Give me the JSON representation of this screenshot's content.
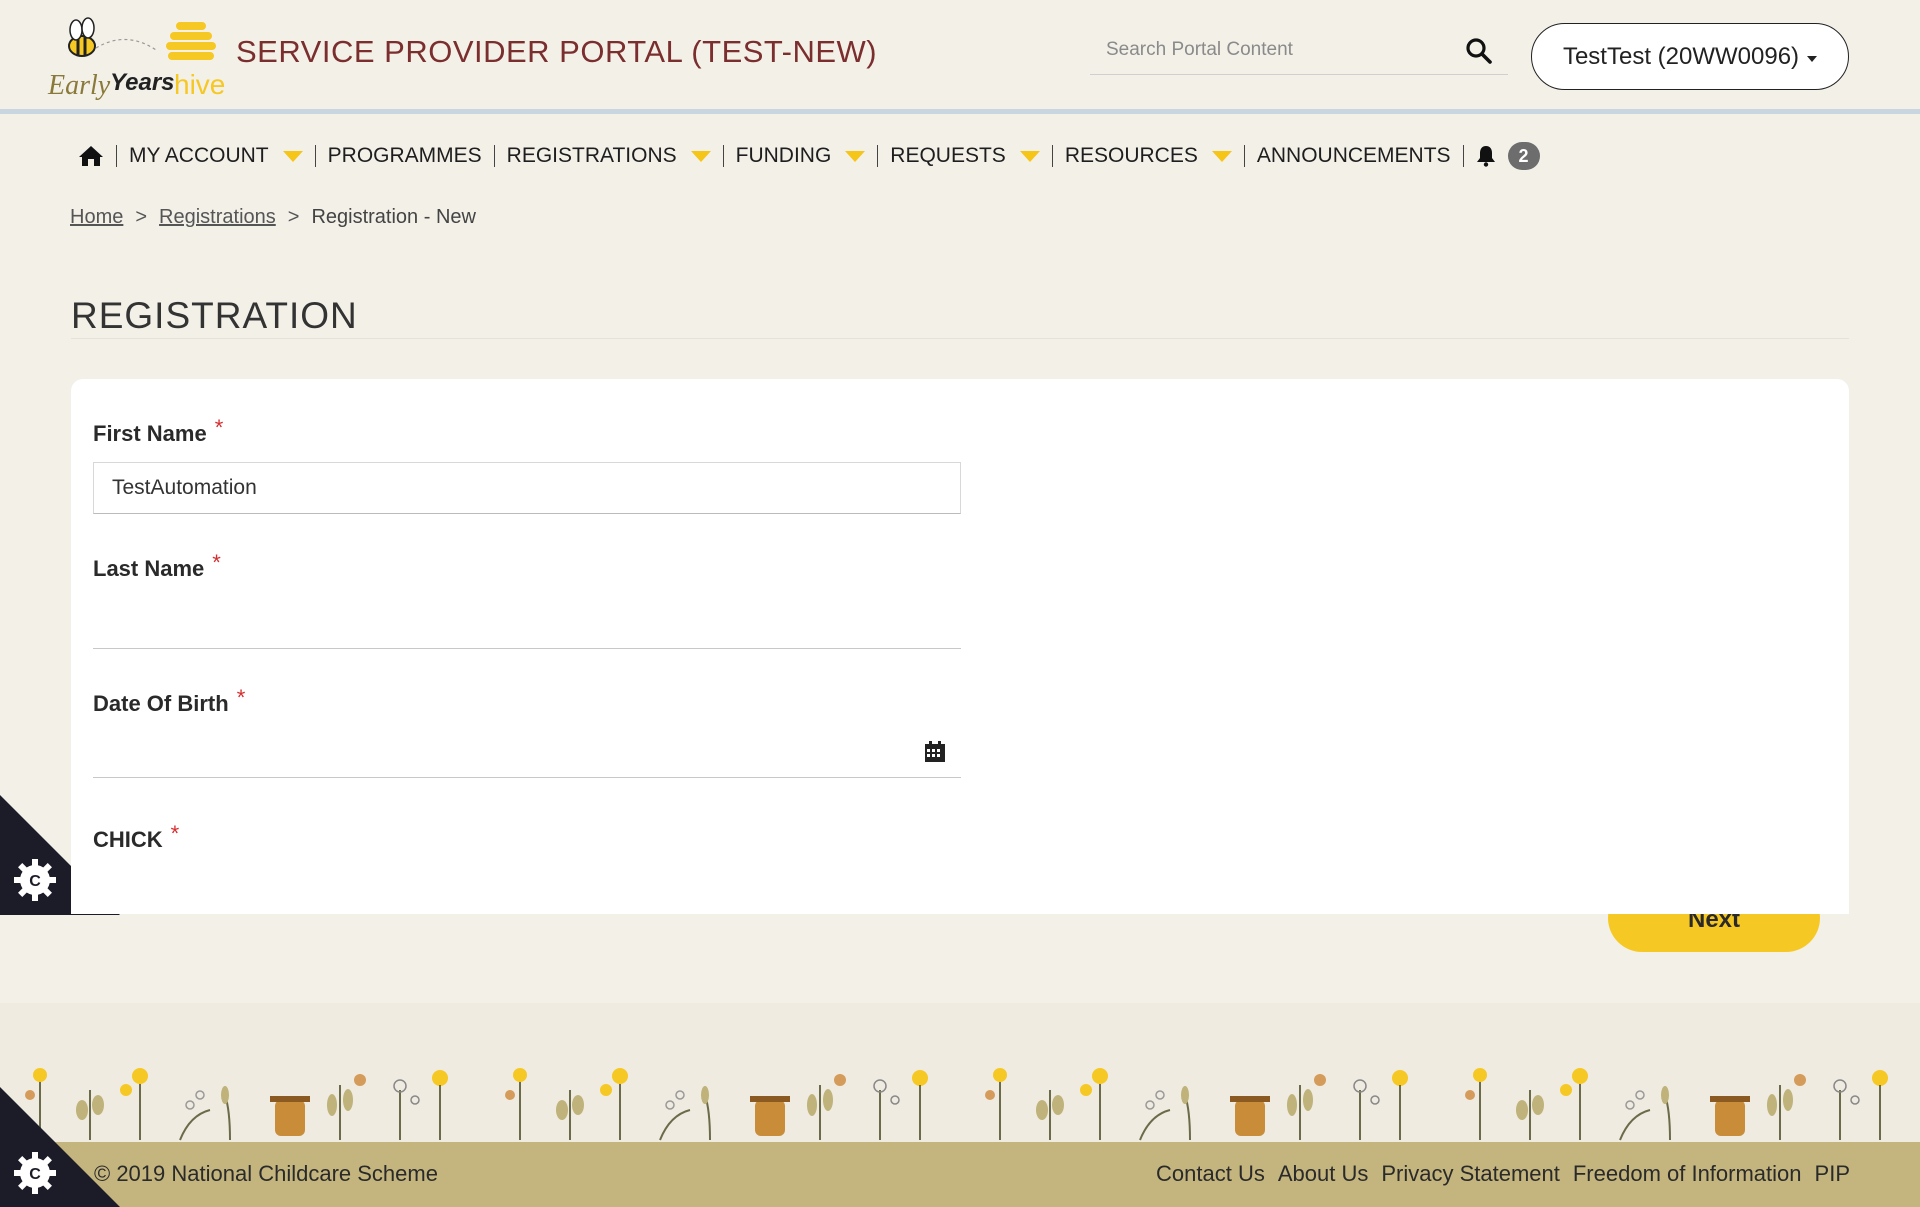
{
  "header": {
    "logo_alt": "Early Years hive",
    "logo_word_1": "Early",
    "logo_word_2": "Years",
    "logo_word_3": "hive",
    "portal_title": "SERVICE PROVIDER PORTAL (TEST-NEW)",
    "search_placeholder": "Search Portal Content",
    "account_label": "TestTest (20WW0096)"
  },
  "nav": {
    "items": [
      {
        "label": "MY ACCOUNT",
        "dropdown": true
      },
      {
        "label": "PROGRAMMES",
        "dropdown": false
      },
      {
        "label": "REGISTRATIONS",
        "dropdown": true
      },
      {
        "label": "FUNDING",
        "dropdown": true
      },
      {
        "label": "REQUESTS",
        "dropdown": true
      },
      {
        "label": "RESOURCES",
        "dropdown": true
      },
      {
        "label": "ANNOUNCEMENTS",
        "dropdown": false
      }
    ],
    "notification_count": "2"
  },
  "breadcrumb": {
    "home": "Home",
    "registrations": "Registrations",
    "current": "Registration - New",
    "separator": ">"
  },
  "page": {
    "title": "REGISTRATION"
  },
  "form": {
    "first_name_label": "First Name",
    "first_name_value": "TestAutomation",
    "last_name_label": "Last Name",
    "last_name_value": "",
    "dob_label": "Date Of Birth",
    "dob_value": "",
    "chick_label": "CHICK",
    "required_marker": "*"
  },
  "actions": {
    "next_label": "Next"
  },
  "footer": {
    "copyright": "© 2019 National Childcare Scheme",
    "links": [
      "Contact Us",
      "About Us",
      "Privacy Statement",
      "Freedom of Information",
      "PIP"
    ]
  },
  "colors": {
    "background": "#f3f0e8",
    "title_red": "#7a2e2e",
    "accent_yellow": "#f6c823",
    "footer_bar": "#c4b57e",
    "required": "#d32f2f"
  },
  "icons": {
    "home": "home-icon",
    "search": "search-icon",
    "bell": "bell-icon",
    "calendar": "calendar-icon",
    "cookie": "cookie-settings-icon"
  }
}
